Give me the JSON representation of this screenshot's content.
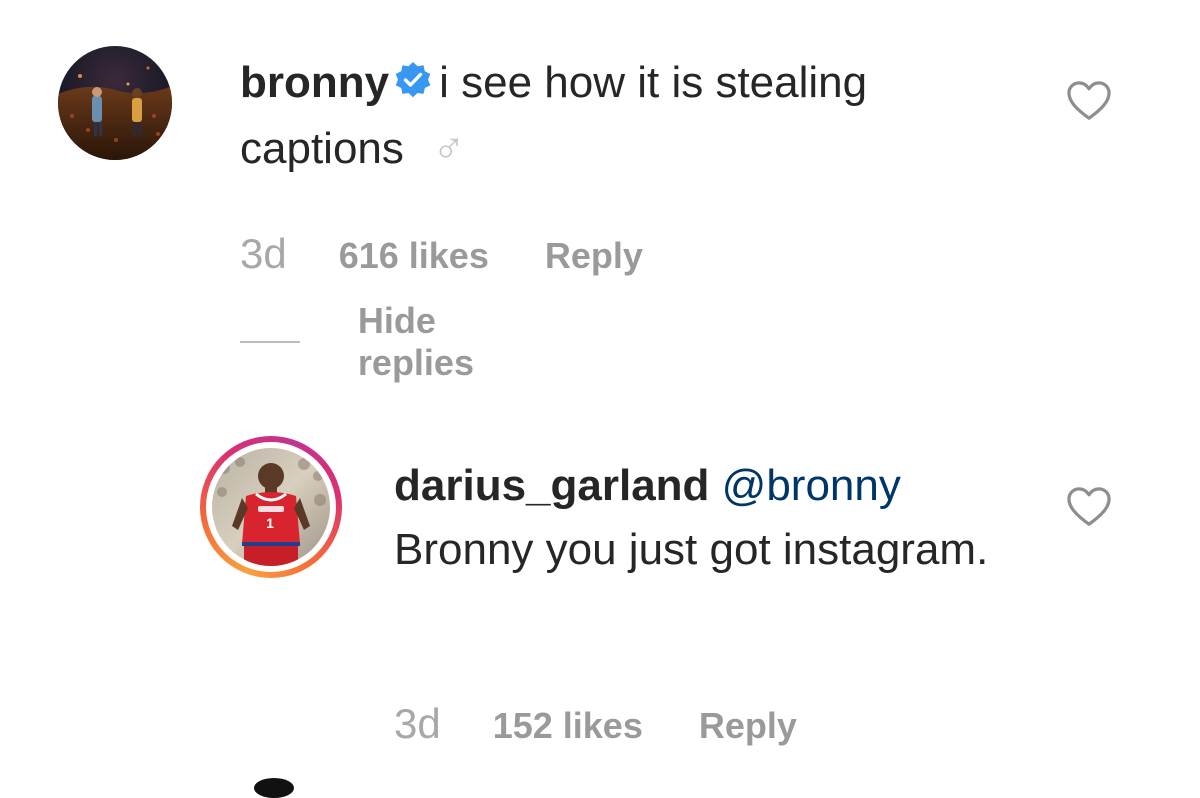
{
  "comments": [
    {
      "username": "bronny",
      "verified": true,
      "text": "i see how it is stealing captions",
      "text_tail": "  ♂",
      "time": "3d",
      "likes": "616 likes",
      "reply_label": "Reply",
      "avatar_icon": "night-scene-avatar",
      "like_icon": "heart-outline-icon"
    }
  ],
  "hide_replies_label": "Hide replies",
  "replies": [
    {
      "username": "darius_garland",
      "mention": "@bronny",
      "text": "Bronny you just got instagram.",
      "time": "3d",
      "likes": "152 likes",
      "reply_label": "Reply",
      "has_story_ring": true,
      "avatar_icon": "basketball-player-avatar",
      "like_icon": "heart-outline-icon"
    }
  ],
  "colors": {
    "text": "#262626",
    "meta": "#9a9a9a",
    "mention": "#003569",
    "verified": "#3897f0"
  }
}
